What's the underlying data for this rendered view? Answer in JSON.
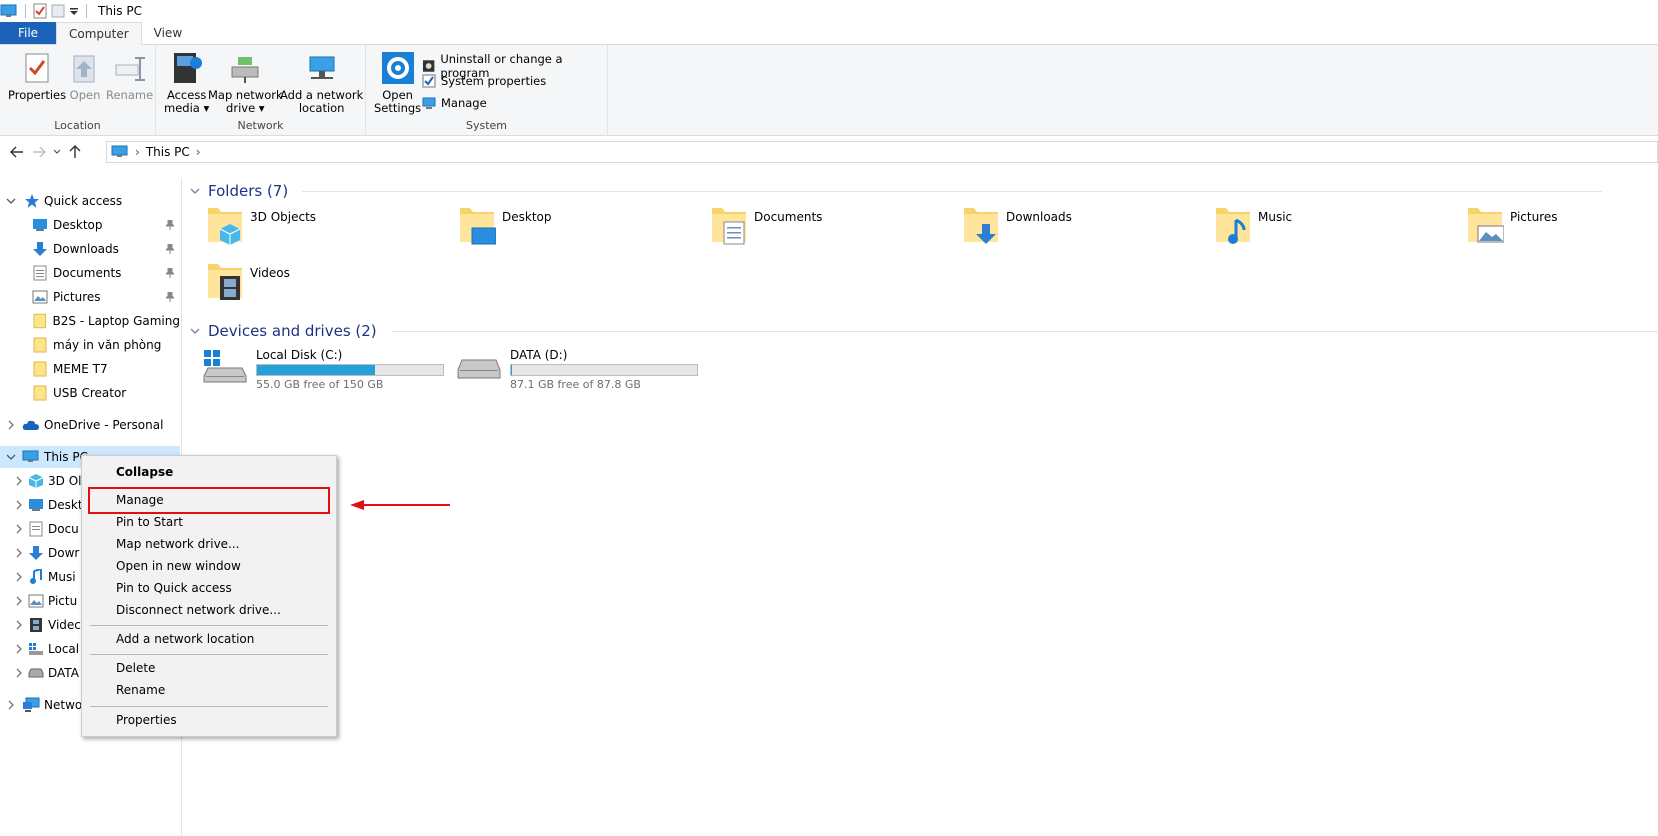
{
  "window": {
    "title": "This PC"
  },
  "tabs": [
    {
      "label": "File"
    },
    {
      "label": "Computer"
    },
    {
      "label": "View"
    }
  ],
  "ribbon": {
    "location": {
      "label": "Location",
      "properties": "Properties",
      "open": "Open",
      "rename": "Rename"
    },
    "network": {
      "label": "Network",
      "access_media_1": "Access",
      "access_media_2": "media",
      "map_drive_1": "Map network",
      "map_drive_2": "drive",
      "add_location_1": "Add a network",
      "add_location_2": "location"
    },
    "system": {
      "label": "System",
      "open_settings_1": "Open",
      "open_settings_2": "Settings",
      "uninstall": "Uninstall or change a program",
      "system_properties": "System properties",
      "manage": "Manage"
    }
  },
  "address": {
    "crumb": "This PC"
  },
  "sidebar": {
    "quick_access": "Quick access",
    "pinned": [
      "Desktop",
      "Downloads",
      "Documents",
      "Pictures"
    ],
    "recent": [
      "B2S - Laptop Gaming",
      "máy in văn phòng",
      "MEME T7",
      "USB Creator"
    ],
    "onedrive": "OneDrive - Personal",
    "this_pc": "This PC",
    "this_pc_children": [
      "3D Ol",
      "Deskt",
      "Docu",
      "Dowr",
      "Musi",
      "Pictu",
      "Videc",
      "Local",
      "DATA"
    ],
    "network": "Netwo"
  },
  "folders_section": {
    "title": "Folders (7)"
  },
  "folders": [
    "3D Objects",
    "Desktop",
    "Documents",
    "Downloads",
    "Music",
    "Pictures",
    "Videos"
  ],
  "drives_section": {
    "title": "Devices and drives (2)"
  },
  "drives": [
    {
      "name": "Local Disk (C:)",
      "free": "55.0 GB free of 150 GB",
      "used_fraction": 0.633
    },
    {
      "name": "DATA (D:)",
      "free": "87.1 GB free of 87.8 GB",
      "used_fraction": 0.008
    }
  ],
  "context_menu": {
    "collapse": "Collapse",
    "manage": "Manage",
    "pin_start": "Pin to Start",
    "map_drive": "Map network drive...",
    "open_new": "Open in new window",
    "pin_quick": "Pin to Quick access",
    "disconnect": "Disconnect network drive...",
    "add_location": "Add a network location",
    "delete": "Delete",
    "rename": "Rename",
    "properties": "Properties"
  },
  "colors": {
    "accent": "#1a63b8",
    "selection": "#cce8ff",
    "annotation": "#e01010",
    "drive_bar": "#26a0da"
  }
}
